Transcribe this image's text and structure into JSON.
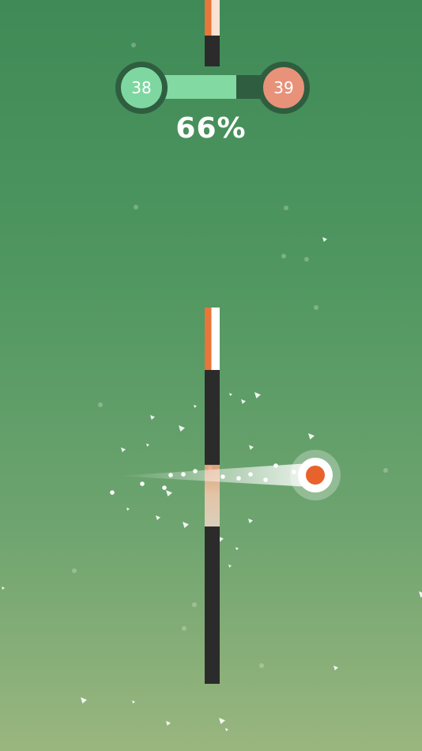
{
  "hud": {
    "current_level": "38",
    "next_level": "39",
    "progress_percent": 66,
    "progress_text": "66%"
  },
  "colors": {
    "accent_green": "#7ed7a0",
    "accent_orange": "#e8622c",
    "next_level_color": "#e8927a",
    "pole_color": "#2b2b2b"
  },
  "game": {
    "ball_icon": "orange-ball-in-white-ring",
    "obstacle": "vertical-pole"
  }
}
